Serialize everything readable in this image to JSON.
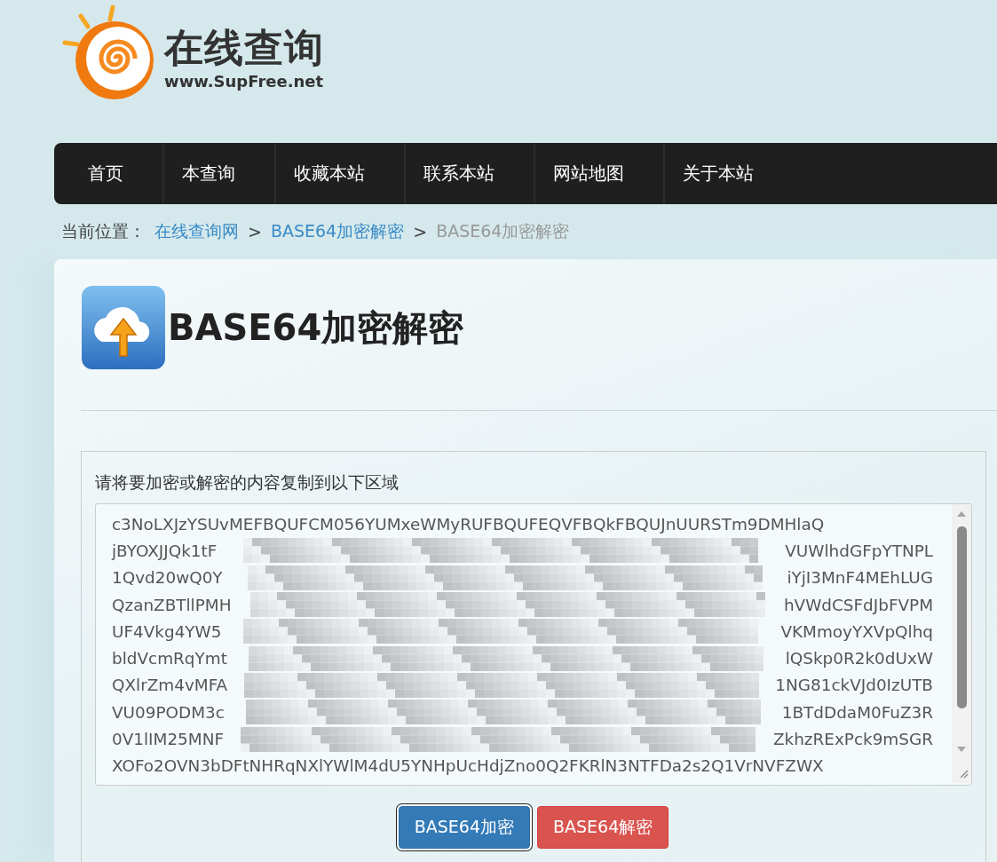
{
  "logo": {
    "title": "在线查询",
    "subtitle": "www.SupFree.net"
  },
  "nav": [
    {
      "label": "首页"
    },
    {
      "label": "本查询"
    },
    {
      "label": "收藏本站"
    },
    {
      "label": "联系本站"
    },
    {
      "label": "网站地图"
    },
    {
      "label": "关于本站"
    }
  ],
  "breadcrumb": {
    "prefix": "当前位置：",
    "links": [
      "在线查询网",
      "BASE64加密解密"
    ],
    "separator": ">",
    "current": "BASE64加密解密"
  },
  "page_title": "BASE64加密解密",
  "form": {
    "label": "请将要加密或解密的内容复制到以下区域",
    "lines": [
      {
        "kind": "plain",
        "text": "c3NoLXJzYSUvMEFBQUFCM056YUMxeWMyRUFBQUFEQVFBQkFBQUJnUURSTm9DMHlaQ"
      },
      {
        "kind": "redacted",
        "start": "jBYOXJJQk1tF",
        "end": "VUWlhdGFpYTNPL"
      },
      {
        "kind": "redacted",
        "start": "1Qvd20wQ0Y",
        "end": "iYjI3MnF4MEhLUG"
      },
      {
        "kind": "redacted",
        "start": "QzanZBTllPMH",
        "end": "hVWdCSFdJbFVPM"
      },
      {
        "kind": "redacted",
        "start": "UF4Vkg4YW5",
        "end": "VKMmoyYXVpQlhq"
      },
      {
        "kind": "redacted",
        "start": "bldVcmRqYmt",
        "end": "lQSkp0R2k0dUxW"
      },
      {
        "kind": "redacted",
        "start": "QXlrZm4vMFA",
        "end": "1NG81ckVJd0IzUTB"
      },
      {
        "kind": "redacted",
        "start": "VU09PODM3c",
        "end": "1BTdDdaM0FuZ3R"
      },
      {
        "kind": "redacted",
        "start": "0V1lIM25MNF",
        "end": "ZkhzRExPck9mSGR"
      },
      {
        "kind": "plain",
        "text": "XOFo2OVN3bDFtNHRqNXlYWlM4dU5YNHpUcHdjZno0Q2FKRlN3NTFDa2s2Q1VrNVFZWX"
      }
    ],
    "buttons": [
      {
        "label": "BASE64加密",
        "kind": "primary",
        "focused": true
      },
      {
        "label": "BASE64解密",
        "kind": "danger",
        "focused": false
      }
    ]
  }
}
